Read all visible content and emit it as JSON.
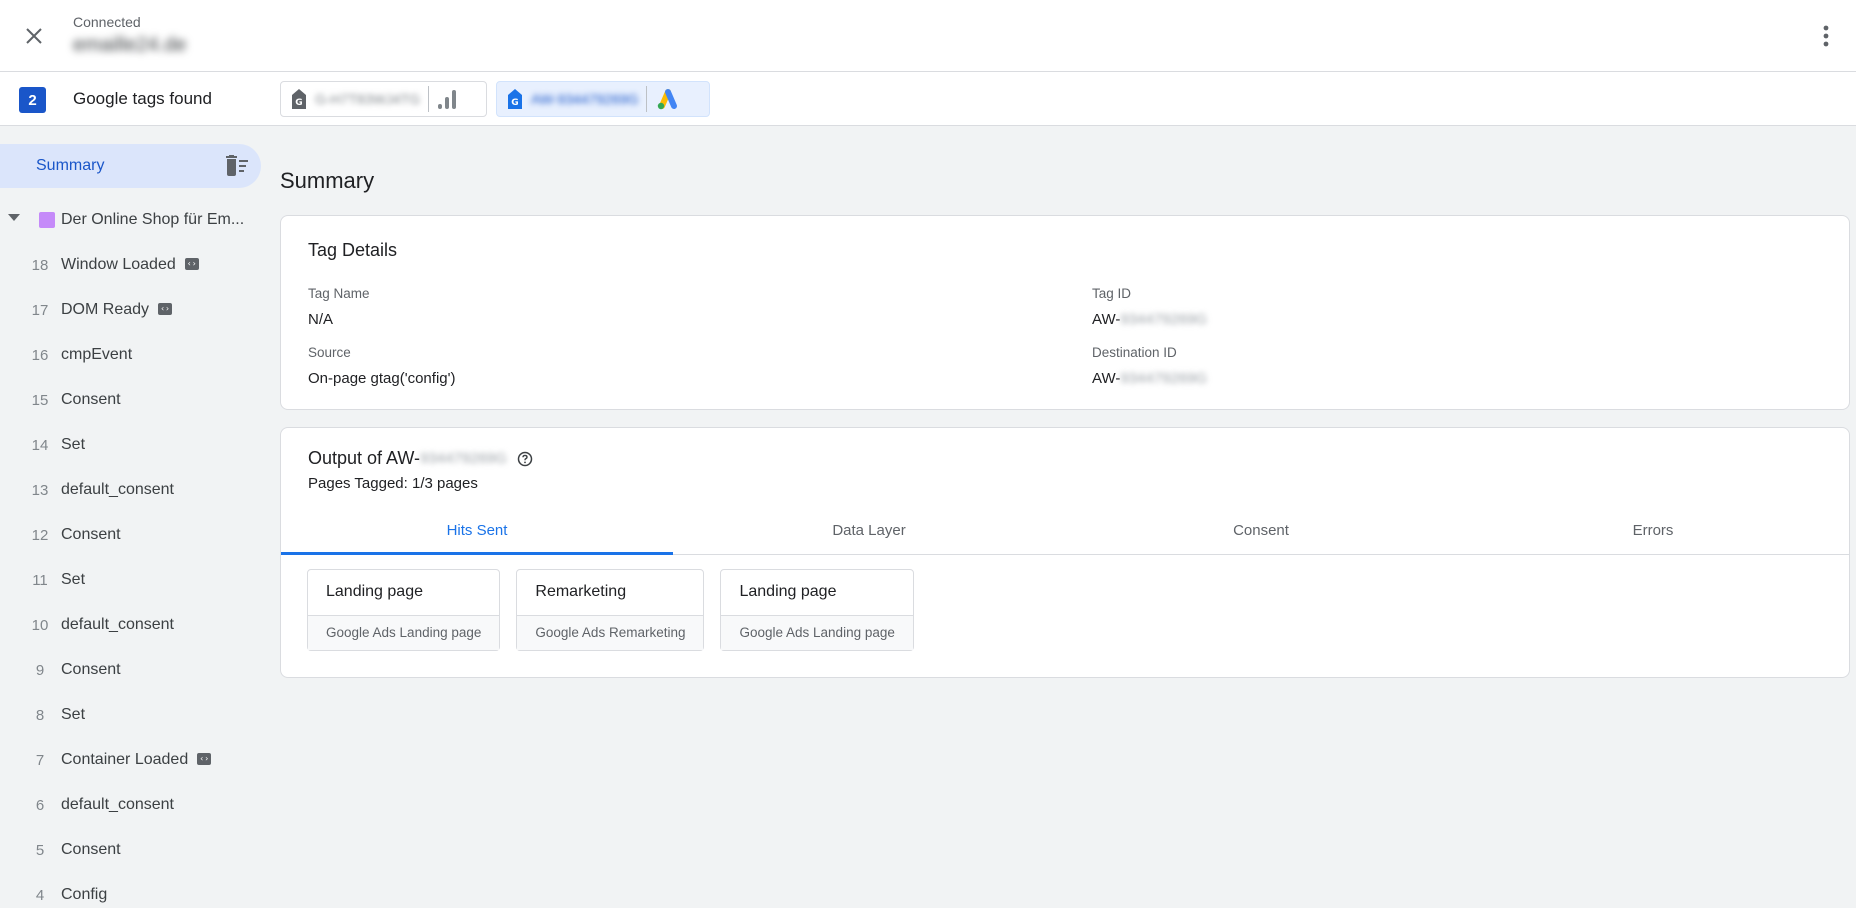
{
  "header": {
    "status": "Connected",
    "domain": "emaille24.de"
  },
  "tagbar": {
    "count": "2",
    "label": "Google tags found",
    "tags": [
      {
        "id": "G-H7T83WJ4TG",
        "product": "google-analytics"
      },
      {
        "id": "AW-934479269G",
        "product": "google-ads"
      }
    ]
  },
  "sidebar": {
    "summary_label": "Summary",
    "page_title": "Der Online Shop für Em...",
    "events": [
      {
        "num": "18",
        "name": "Window Loaded",
        "code": true
      },
      {
        "num": "17",
        "name": "DOM Ready",
        "code": true
      },
      {
        "num": "16",
        "name": "cmpEvent",
        "code": false
      },
      {
        "num": "15",
        "name": "Consent",
        "code": false
      },
      {
        "num": "14",
        "name": "Set",
        "code": false
      },
      {
        "num": "13",
        "name": "default_consent",
        "code": false
      },
      {
        "num": "12",
        "name": "Consent",
        "code": false
      },
      {
        "num": "11",
        "name": "Set",
        "code": false
      },
      {
        "num": "10",
        "name": "default_consent",
        "code": false
      },
      {
        "num": "9",
        "name": "Consent",
        "code": false
      },
      {
        "num": "8",
        "name": "Set",
        "code": false
      },
      {
        "num": "7",
        "name": "Container Loaded",
        "code": true
      },
      {
        "num": "6",
        "name": "default_consent",
        "code": false
      },
      {
        "num": "5",
        "name": "Consent",
        "code": false
      },
      {
        "num": "4",
        "name": "Config",
        "code": false
      }
    ]
  },
  "main": {
    "title": "Summary",
    "details": {
      "title": "Tag Details",
      "tag_name_label": "Tag Name",
      "tag_name_value": "N/A",
      "tag_id_label": "Tag ID",
      "tag_id_prefix": "AW-",
      "tag_id_hidden": "934479269G",
      "source_label": "Source",
      "source_value": "On-page gtag('config')",
      "destination_label": "Destination ID",
      "destination_prefix": "AW-",
      "destination_hidden": "934479269G"
    },
    "output": {
      "title_prefix": "Output of AW-",
      "title_hidden": "934479269G",
      "pages_tagged": "Pages Tagged: 1/3 pages",
      "tabs": [
        "Hits Sent",
        "Data Layer",
        "Consent",
        "Errors"
      ],
      "active_tab": 0,
      "hits": [
        {
          "name": "Landing page",
          "type": "Google Ads Landing page"
        },
        {
          "name": "Remarketing",
          "type": "Google Ads Remarketing"
        },
        {
          "name": "Landing page",
          "type": "Google Ads Landing page"
        }
      ]
    }
  },
  "colors": {
    "accent": "#1a73e8",
    "badge": "#1a56c9",
    "page_square": "#c58af9",
    "selected_bg": "#dbe5fb"
  }
}
